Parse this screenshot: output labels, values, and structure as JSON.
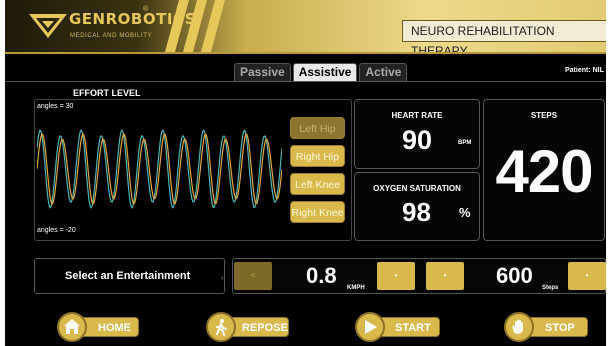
{
  "header": {
    "brand": "GENROBOTICS",
    "brand_sub": "MEDICAL AND MOBILITY",
    "trademark": "®",
    "screen_title": "NEURO REHABILITATION THERAPY"
  },
  "tabs": [
    {
      "label": "Passive",
      "active": false
    },
    {
      "label": "Assistive",
      "active": true
    },
    {
      "label": "Active",
      "active": false
    }
  ],
  "patient": "Patient: NIL",
  "effort": {
    "label": "EFFORT LEVEL",
    "angle_top": "angles = 30",
    "angle_bottom": "angles = -20",
    "series_colors": {
      "orange": "#e3a83a",
      "teal": "#4fb7b3"
    },
    "joints": [
      {
        "label": "Left Hip",
        "state": "dim"
      },
      {
        "label": "Right Hip",
        "state": "on"
      },
      {
        "label": "Left Knee",
        "state": "on"
      },
      {
        "label": "Right Knee",
        "state": "on"
      }
    ]
  },
  "vitals": {
    "heart_rate": {
      "title": "HEART RATE",
      "value": "90",
      "unit": "BPM"
    },
    "oxygen": {
      "title": "OXYGEN SATURATION",
      "value": "98",
      "unit": "%"
    },
    "steps": {
      "title": "STEPS",
      "value": "420"
    }
  },
  "controls": {
    "entertainment": "Select an Entertainment",
    "speed_value": "0.8",
    "speed_unit": "KMPH",
    "steps_goal_value": "600",
    "steps_goal_unit": "Steps",
    "minus_glyph": "<",
    "dot_glyph": "•"
  },
  "actions": [
    {
      "label": "HOME",
      "icon": "home-icon"
    },
    {
      "label": "REPOSE",
      "icon": "walking-person-icon"
    },
    {
      "label": "START",
      "icon": "play-icon"
    },
    {
      "label": "STOP",
      "icon": "hand-stop-icon"
    }
  ],
  "colors": {
    "accent": "#d9b94c",
    "background": "#000000"
  }
}
